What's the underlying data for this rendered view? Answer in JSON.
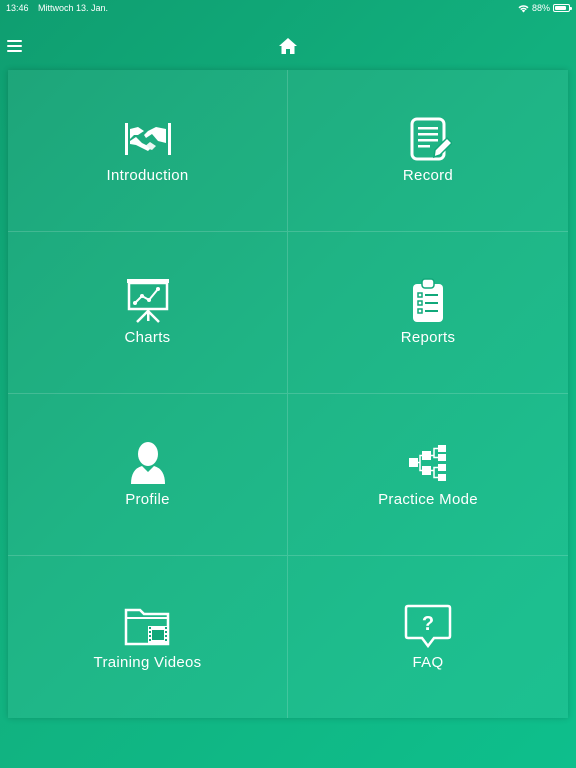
{
  "status_bar": {
    "time": "13:46",
    "date": "Mittwoch 13. Jan.",
    "battery": "88%",
    "battery_level": 0.88
  },
  "nav": {
    "menu_icon": "hamburger-icon",
    "home_icon": "home-icon"
  },
  "tiles": [
    {
      "label": "Introduction",
      "icon": "handshake-icon"
    },
    {
      "label": "Record",
      "icon": "document-edit-icon"
    },
    {
      "label": "Charts",
      "icon": "presentation-chart-icon"
    },
    {
      "label": "Reports",
      "icon": "clipboard-checklist-icon"
    },
    {
      "label": "Profile",
      "icon": "person-icon"
    },
    {
      "label": "Practice Mode",
      "icon": "hierarchy-icon"
    },
    {
      "label": "Training Videos",
      "icon": "video-folder-icon"
    },
    {
      "label": "FAQ",
      "icon": "question-bubble-icon"
    }
  ],
  "colors": {
    "background_start": "#0f9e70",
    "background_end": "#0ebf8c",
    "foreground": "#ffffff"
  }
}
